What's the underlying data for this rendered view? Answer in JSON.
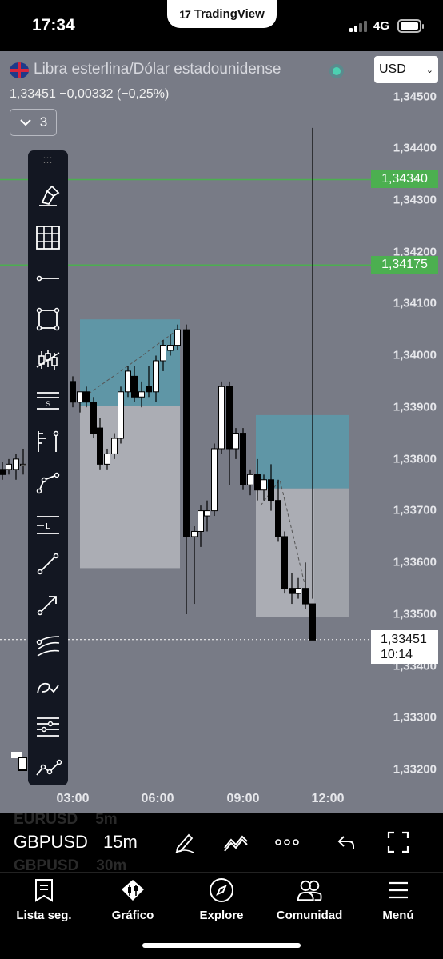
{
  "status_bar": {
    "time": "17:34",
    "center_app": "TradingView",
    "network": "4G",
    "icons": [
      "tradingview-logo-icon",
      "signal-icon",
      "battery-icon"
    ]
  },
  "chart": {
    "symbol_name": "Libra esterlina/Dólar estadounidense",
    "price_change": "1,33451 −0,00332 (−0,25%)",
    "indicator_count": "3",
    "currency": "USD",
    "colors": {
      "background": "#787b86",
      "candle_up": "#ffffff",
      "candle_down": "#000000",
      "target_zone": "#5b9bab",
      "stop_zone": "#b4b6bc",
      "horizontal_lines": "#4caf50"
    },
    "horizontal_lines": [
      {
        "label": "1,34340",
        "price": 1.3434
      },
      {
        "label": "1,34175",
        "price": 1.34175
      }
    ],
    "current_price": {
      "price": "1,33451",
      "countdown": "10:14"
    },
    "price_axis_labels": [
      "1,34500",
      "1,34400",
      "1,34300",
      "1,34200",
      "1,34100",
      "1,34000",
      "1,33900",
      "1,33800",
      "1,33700",
      "1,33600",
      "1,33500",
      "1,33400",
      "1,33300",
      "1,33200"
    ],
    "time_axis_labels": [
      "03:00",
      "06:00",
      "09:00",
      "12:00"
    ]
  },
  "toolbar": {
    "tools": [
      "brush-icon",
      "grid-icon",
      "ray-icon",
      "rectangle-icon",
      "pattern-icon",
      "long-short-icon",
      "fib-icon",
      "path-icon",
      "price-label-icon",
      "trend-line-icon",
      "arrow-line-icon",
      "parallel-channel-icon",
      "annotation-icon",
      "horizontal-lines-icon",
      "forecast-icon"
    ]
  },
  "symbol_bar": {
    "ghost_rows": [
      {
        "ticker": "EURUSD",
        "tf": "5m"
      },
      {
        "ticker": "GBPUSD",
        "tf": "30m"
      }
    ],
    "ticker": "GBPUSD",
    "timeframe": "15m",
    "icons": [
      "draw-icon",
      "indicators-icon",
      "more-icon",
      "undo-icon",
      "fullscreen-icon"
    ]
  },
  "tabs": [
    {
      "label": "Lista seg.",
      "icon": "watchlist-icon"
    },
    {
      "label": "Gráfico",
      "icon": "chart-icon"
    },
    {
      "label": "Explore",
      "icon": "compass-icon"
    },
    {
      "label": "Comunidad",
      "icon": "community-icon"
    },
    {
      "label": "Menú",
      "icon": "menu-icon"
    }
  ]
}
